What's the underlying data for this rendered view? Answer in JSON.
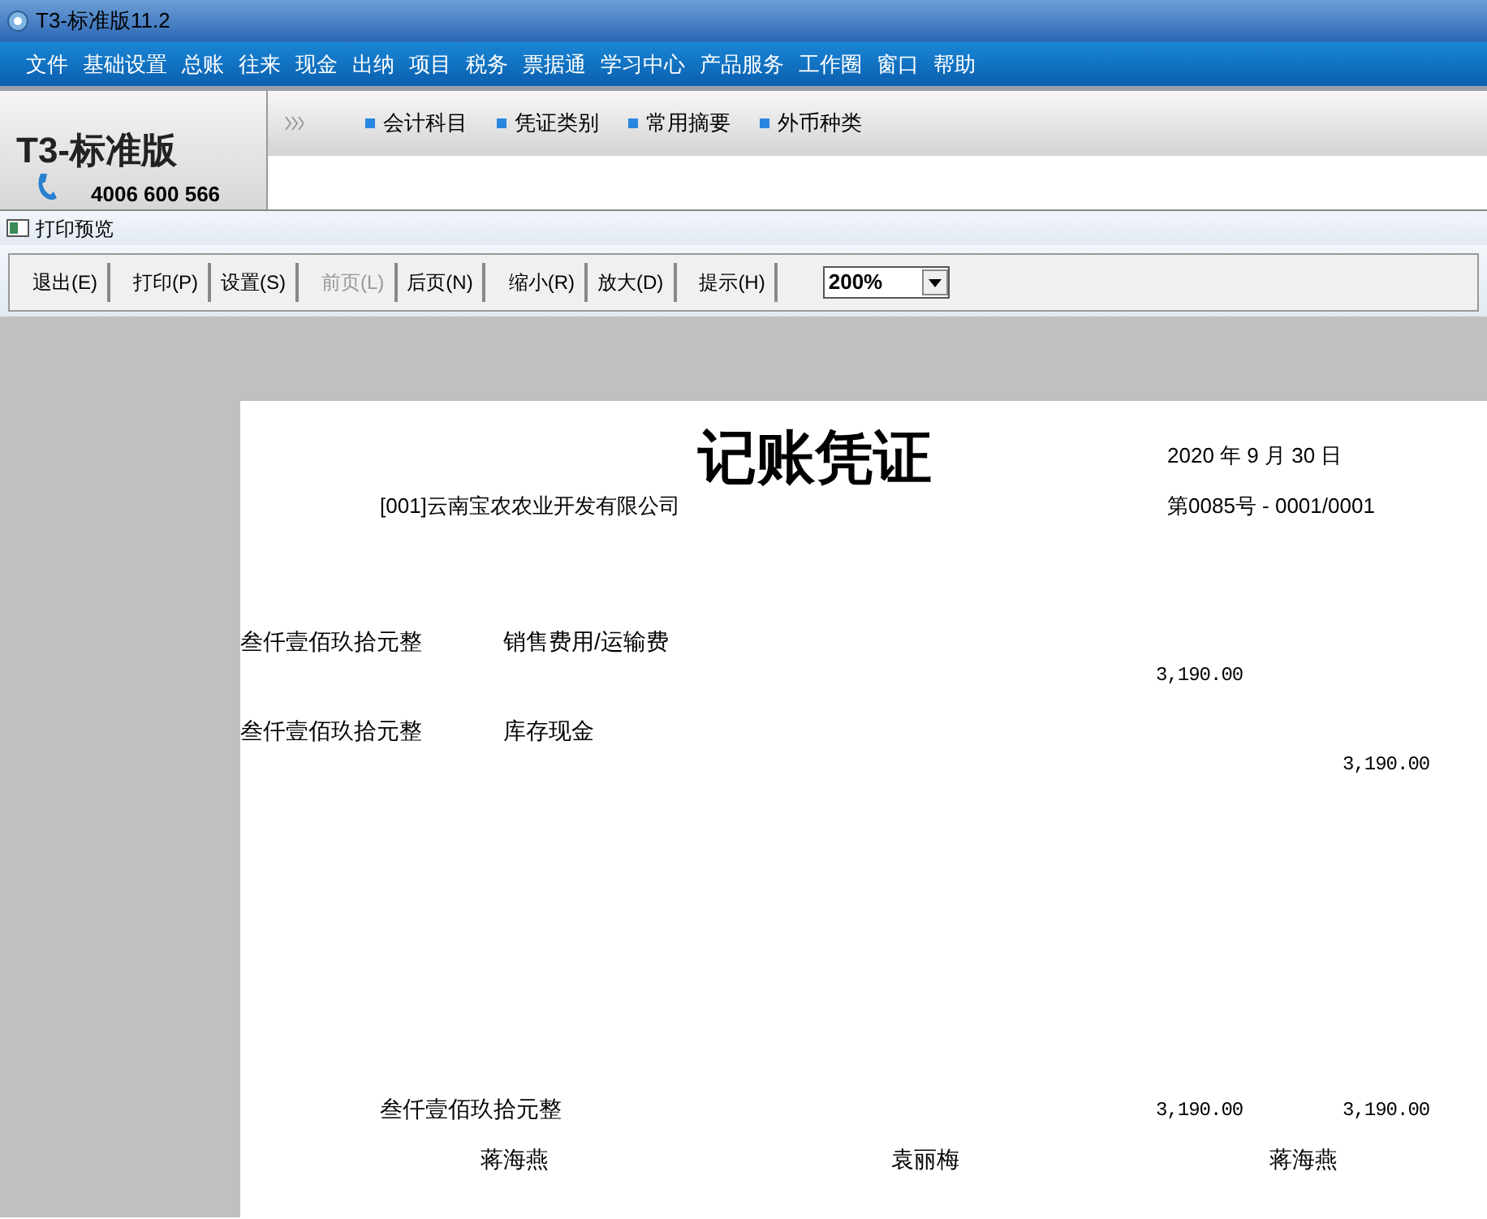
{
  "window": {
    "title": "T3-标准版11.2"
  },
  "menu": [
    "文件",
    "基础设置",
    "总账",
    "往来",
    "现金",
    "出纳",
    "项目",
    "税务",
    "票据通",
    "学习中心",
    "产品服务",
    "工作圈",
    "窗口",
    "帮助"
  ],
  "logo": {
    "brand": "T3-标准版",
    "phone": "4006 600 566"
  },
  "quick_links": [
    "会计科目",
    "凭证类别",
    "常用摘要",
    "外币种类"
  ],
  "preview": {
    "title": "打印预览",
    "toolbar": [
      {
        "label": "退出(E)",
        "disabled": false
      },
      {
        "label": "打印(P)",
        "disabled": false
      },
      {
        "label": "设置(S)",
        "disabled": false
      },
      {
        "label": "前页(L)",
        "disabled": true
      },
      {
        "label": "后页(N)",
        "disabled": false
      },
      {
        "label": "缩小(R)",
        "disabled": false
      },
      {
        "label": "放大(D)",
        "disabled": false
      },
      {
        "label": "提示(H)",
        "disabled": false
      }
    ],
    "zoom": "200%"
  },
  "voucher": {
    "title": "记账凭证",
    "date": "2020 年 9 月 30 日",
    "company": "[001]云南宝农农业开发有限公司",
    "number": "第0085号 - 0001/0001",
    "entries": [
      {
        "summary": "叁仟壹佰玖拾元整",
        "account": "销售费用/运输费",
        "debit": "3,190.00"
      },
      {
        "summary": "叁仟壹佰玖拾元整",
        "account": "库存现金",
        "credit": "3,190.00"
      }
    ],
    "total": {
      "words": "叁仟壹佰玖拾元整",
      "debit": "3,190.00",
      "credit": "3,190.00"
    },
    "signatures": [
      "蒋海燕",
      "袁丽梅",
      "蒋海燕"
    ]
  }
}
